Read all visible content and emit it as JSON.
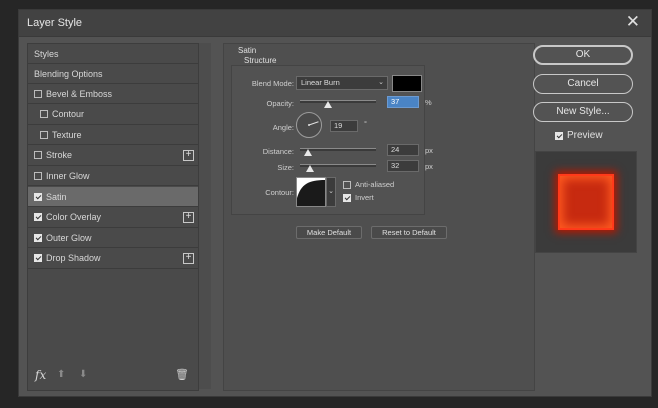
{
  "window": {
    "title": "Layer Style"
  },
  "styles_list": {
    "header": "Styles",
    "blending_options": "Blending Options",
    "items": [
      {
        "label": "Bevel & Emboss",
        "checked": false,
        "indent": false,
        "plus": false
      },
      {
        "label": "Contour",
        "checked": false,
        "indent": true,
        "plus": false
      },
      {
        "label": "Texture",
        "checked": false,
        "indent": true,
        "plus": false
      },
      {
        "label": "Stroke",
        "checked": false,
        "indent": false,
        "plus": true
      },
      {
        "label": "Inner Glow",
        "checked": false,
        "indent": false,
        "plus": false
      },
      {
        "label": "Satin",
        "checked": true,
        "indent": false,
        "plus": false,
        "selected": true
      },
      {
        "label": "Color Overlay",
        "checked": true,
        "indent": false,
        "plus": true
      },
      {
        "label": "Outer Glow",
        "checked": true,
        "indent": false,
        "plus": false
      },
      {
        "label": "Drop Shadow",
        "checked": true,
        "indent": false,
        "plus": true
      }
    ],
    "footer": {
      "fx_label": "fx"
    }
  },
  "satin": {
    "section_title": "Satin",
    "structure_title": "Structure",
    "blend_mode": {
      "label": "Blend Mode:",
      "value": "Linear Burn",
      "color": "#000000"
    },
    "opacity": {
      "label": "Opacity:",
      "value": "37",
      "unit": "%",
      "fraction": 0.37
    },
    "angle": {
      "label": "Angle:",
      "value": "19",
      "unit": "°",
      "degrees": 19
    },
    "distance": {
      "label": "Distance:",
      "value": "24",
      "unit": "px",
      "fraction": 0.1
    },
    "size": {
      "label": "Size:",
      "value": "32",
      "unit": "px",
      "fraction": 0.13
    },
    "contour": {
      "label": "Contour:"
    },
    "anti_aliased": {
      "label": "Anti-aliased",
      "checked": false
    },
    "invert": {
      "label": "Invert",
      "checked": true
    }
  },
  "actions": {
    "make_default": "Make Default",
    "reset_to_default": "Reset to Default"
  },
  "buttons": {
    "ok": "OK",
    "cancel": "Cancel",
    "new_style": "New Style...",
    "preview": {
      "label": "Preview",
      "checked": true
    }
  },
  "colors": {
    "preview_fill": "#c72a10",
    "selection_highlight": "#4a84c5"
  }
}
